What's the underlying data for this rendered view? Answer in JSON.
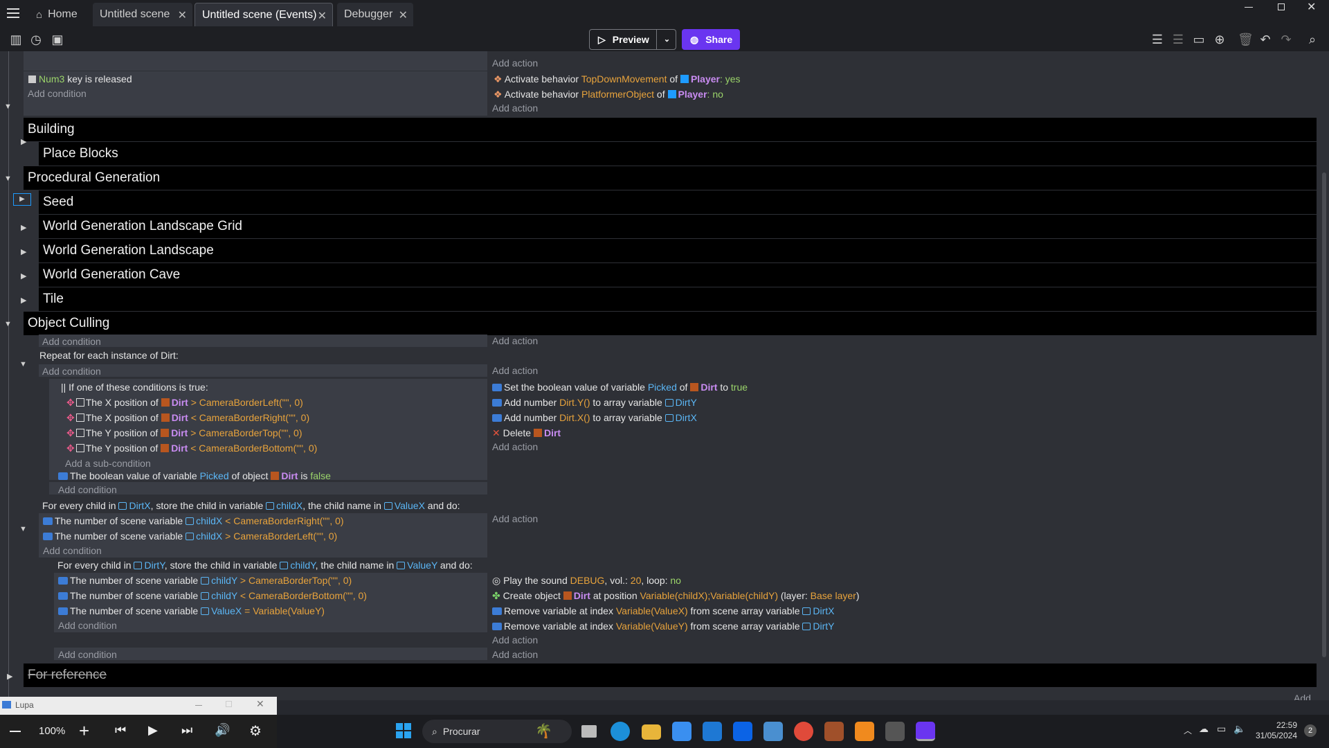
{
  "titlebar": {
    "home": "Home",
    "tabs": [
      "Untitled scene",
      "Untitled scene (Events)",
      "Debugger"
    ]
  },
  "toolbar": {
    "preview": "Preview",
    "share": "Share"
  },
  "events": {
    "top_add_action": "Add action",
    "num3": {
      "key": "Num3",
      "text": "key is released",
      "add_condition": "Add condition",
      "actions": [
        {
          "pre": "Activate behavior",
          "behavior": "TopDownMovement",
          "of": "of",
          "obj": "Player",
          "val": ": yes"
        },
        {
          "pre": "Activate behavior",
          "behavior": "PlatformerObject",
          "of": "of",
          "obj": "Player",
          "val": ": no"
        }
      ],
      "add_action": "Add action"
    },
    "groups": {
      "building": "Building",
      "place_blocks": "Place Blocks",
      "procgen": "Procedural Generation",
      "seed": "Seed",
      "wglg": "World Generation Landscape Grid",
      "wgl": "World Generation Landscape",
      "wgc": "World Generation Cave",
      "tile": "Tile",
      "culling": "Object Culling",
      "for_reference": "For reference"
    },
    "culling": {
      "add_condition": "Add condition",
      "add_action": "Add action",
      "repeat": "Repeat for each instance of Dirt:",
      "or_title": "If one of these conditions is true:",
      "or_conds": [
        {
          "a": "The X position of",
          "obj": "Dirt",
          "op": ">",
          "b": "CameraBorderLeft(\"\", 0)"
        },
        {
          "a": "The X position of",
          "obj": "Dirt",
          "op": "<",
          "b": "CameraBorderRight(\"\", 0)"
        },
        {
          "a": "The Y position of",
          "obj": "Dirt",
          "op": ">",
          "b": "CameraBorderTop(\"\", 0)"
        },
        {
          "a": "The Y position of",
          "obj": "Dirt",
          "op": "<",
          "b": "CameraBorderBottom(\"\", 0)"
        }
      ],
      "add_sub": "Add a sub-condition",
      "bool_cond": {
        "a": "The boolean value of variable",
        "var": "Picked",
        "b": "of object",
        "obj": "Dirt",
        "c": "is",
        "val": "false"
      },
      "actions1": [
        {
          "a": "Set the boolean value of variable",
          "var": "Picked",
          "b": "of",
          "obj": "Dirt",
          "c": "to",
          "val": "true"
        },
        {
          "a": "Add number",
          "expr": "Dirt.Y()",
          "b": "to array variable",
          "var": "DirtY"
        },
        {
          "a": "Add number",
          "expr": "Dirt.X()",
          "b": "to array variable",
          "var": "DirtX"
        },
        {
          "a": "Delete",
          "obj": "Dirt"
        }
      ],
      "forx": {
        "a": "For every child in",
        "v1": "DirtX",
        "b": ", store the child in variable",
        "v2": "childX",
        "c": ", the child name in",
        "v3": "ValueX",
        "d": "and do:"
      },
      "forx_conds": [
        {
          "a": "The number of scene variable",
          "var": "childX",
          "op": "<",
          "b": "CameraBorderRight(\"\", 0)"
        },
        {
          "a": "The number of scene variable",
          "var": "childX",
          "op": ">",
          "b": "CameraBorderLeft(\"\", 0)"
        }
      ],
      "fory": {
        "a": "For every child in",
        "v1": "DirtY",
        "b": ", store the child in variable",
        "v2": "childY",
        "c": ", the child name in",
        "v3": "ValueY",
        "d": "and do:"
      },
      "fory_conds": [
        {
          "a": "The number of scene variable",
          "var": "childY",
          "op": ">",
          "b": "CameraBorderTop(\"\", 0)"
        },
        {
          "a": "The number of scene variable",
          "var": "childY",
          "op": "<",
          "b": "CameraBorderBottom(\"\", 0)"
        },
        {
          "a": "The number of scene variable",
          "var": "ValueX",
          "op": "=",
          "b": "Variable(ValueY)"
        }
      ],
      "fory_actions": [
        {
          "a": "Play the sound",
          "s": "DEBUG",
          "b": ", vol.:",
          "v": "20",
          "c": ", loop:",
          "l": "no"
        },
        {
          "a": "Create object",
          "obj": "Dirt",
          "b": "at position",
          "expr": "Variable(childX);Variable(childY)",
          "c": "(layer:",
          "layer": "Base layer",
          "d": ")"
        },
        {
          "a": "Remove variable at index",
          "expr": "Variable(ValueX)",
          "b": "from scene array variable",
          "var": "DirtX"
        },
        {
          "a": "Remove variable at index",
          "expr": "Variable(ValueY)",
          "b": "from scene array variable",
          "var": "DirtY"
        }
      ]
    },
    "bottom_add": "Add..."
  },
  "lupa": {
    "title": "Lupa",
    "zoom": "100%"
  },
  "taskbar": {
    "search": "Procurar",
    "time": "22:59",
    "date": "31/05/2024",
    "badge": "2"
  }
}
